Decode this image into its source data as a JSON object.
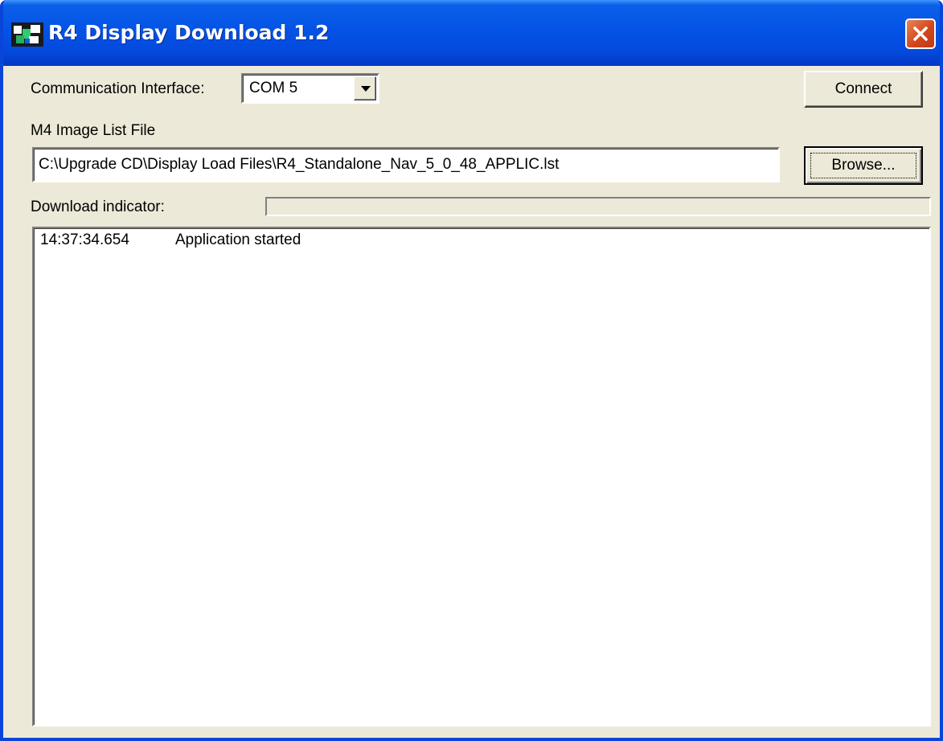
{
  "window": {
    "title": "R4 Display Download 1.2",
    "icon": "app-icon",
    "close_icon": "close-icon"
  },
  "colors": {
    "titlebar": "#0453e6",
    "window_bg": "#ece9d8",
    "close_button": "#d2471c"
  },
  "comm": {
    "label": "Communication Interface:",
    "selected": "COM 5",
    "dropdown_icon": "chevron-down-icon"
  },
  "connect": {
    "label": "Connect"
  },
  "image_list": {
    "label": "M4 Image List File",
    "path": "C:\\Upgrade CD\\Display Load Files\\R4_Standalone_Nav_5_0_48_APPLIC.lst"
  },
  "browse": {
    "label": "Browse..."
  },
  "download": {
    "label": "Download indicator:",
    "progress": 0
  },
  "log": {
    "entries": [
      {
        "time": "14:37:34.654",
        "message": "Application started"
      }
    ]
  }
}
